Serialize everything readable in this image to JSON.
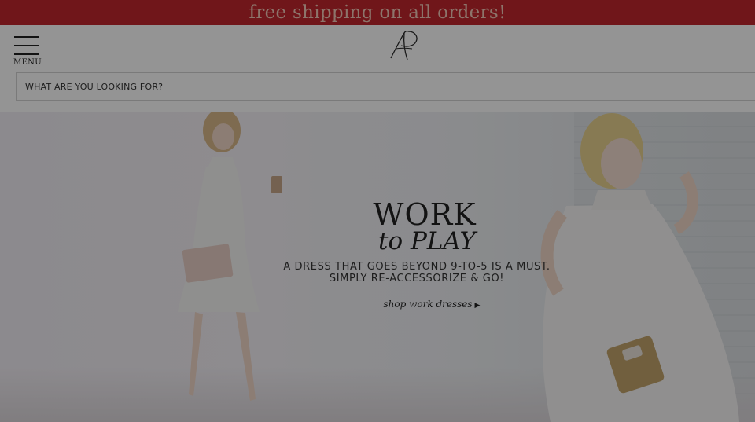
{
  "promo": {
    "text": "free shipping on all orders!"
  },
  "header": {
    "menu_label": "MENU",
    "logo_name": "brand-monogram-logo"
  },
  "search": {
    "placeholder": "WHAT ARE YOU LOOKING FOR?"
  },
  "hero": {
    "title_line1": "WORK",
    "title_line2": "to PLAY",
    "subtitle_line1": "A DRESS THAT GOES BEYOND 9-TO-5 IS A MUST.",
    "subtitle_line2": "SIMPLY RE-ACCESSORIZE & GO!",
    "cta_label": "shop work dresses"
  },
  "colors": {
    "promo_bg": "#c2272d",
    "promo_text": "#f3c9b8",
    "overlay": "rgba(0,0,0,0.42)"
  }
}
